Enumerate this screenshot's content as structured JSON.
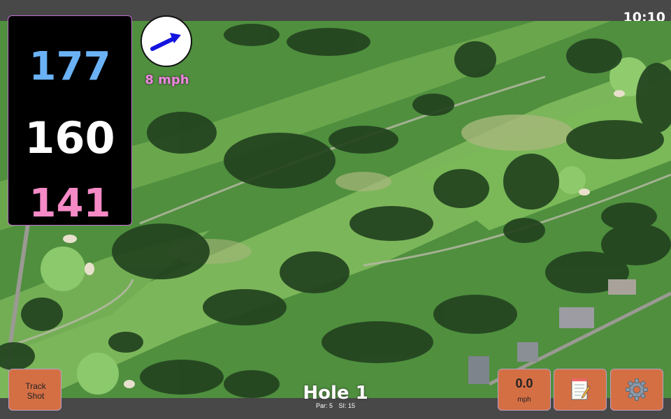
{
  "status_bar": {
    "time": "10:10"
  },
  "distances": {
    "back": "177",
    "middle": "160",
    "front": "141"
  },
  "colors": {
    "back": "#6ab2f5",
    "middle": "#ffffff",
    "front": "#f58ac7",
    "button": "#d46f44",
    "wind_arrow": "#1414e0"
  },
  "wind": {
    "speed_text": "8 mph",
    "direction_icon": "arrow-icon"
  },
  "buttons": {
    "track_shot": "Track Shot",
    "speed_value": "0.0",
    "speed_unit": "mph",
    "notes_icon": "notepad-icon",
    "settings_icon": "gear-icon"
  },
  "hole": {
    "title": "Hole 1",
    "par": "Par: 5",
    "si": "SI: 15"
  }
}
